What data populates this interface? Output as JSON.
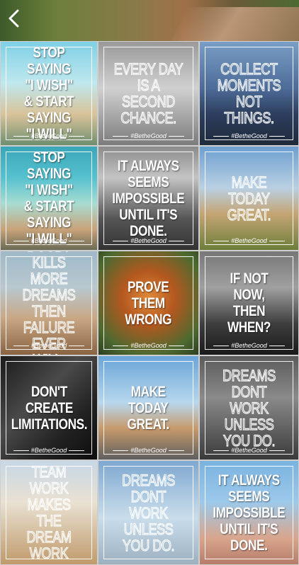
{
  "tiles": [
    {
      "text": "STOP SAYING\n\"I WISH\"\n& START SAYING\n\"I WILL\"",
      "tag": "#BetheGood",
      "bg": "linear-gradient(180deg,#7fd0e6 0%,#bfe8ee 40%,#d9c39a 70%,#6f8f70 100%)",
      "style": "solid"
    },
    {
      "text": "EVERY DAY\nIS A\nSECOND\nCHANCE.",
      "tag": "#BetheGood",
      "bg": "linear-gradient(180deg,#9a9a9a 0%,#d0d0d0 45%,#7c7c7c 100%)",
      "style": "outline"
    },
    {
      "text": "COLLECT\nMOMENTS\nNOT\nTHINGS.",
      "tag": "#BetheGood",
      "bg": "linear-gradient(180deg,#7a9ec6 0%,#4d6c98 45%,#2d3e5e 70%,#1f2a3a 100%)",
      "style": "outline"
    },
    {
      "text": "STOP SAYING\n\"I WISH\"\n& START SAYING\n\"I WILL\"",
      "tag": "#BetheGood",
      "bg": "linear-gradient(180deg,#3aa6b8 0%,#56c1cf 30%,#a7dcd2 55%,#c9a37a 80%,#6b6b55 100%)",
      "style": "solid"
    },
    {
      "text": "IT ALWAYS\nSEEMS IMPOSSIBLE\nUNTIL IT'S DONE.",
      "tag": "#BetheGood",
      "bg": "linear-gradient(180deg,#8b8b8b 0%,#c4c4c4 30%,#555 70%,#333 100%)",
      "style": "solid"
    },
    {
      "text": "MAKE\nTODAY\nGREAT.",
      "tag": "#BetheGood",
      "bg": "linear-gradient(180deg,#6d9fd0 0%,#b9d0e3 40%,#c5a574 65%,#6d7d3a 100%)",
      "style": "outline"
    },
    {
      "text": "DOUBT KILLS\nMORE DREAMS\nTHEN FAILURE\nEVER WILL.",
      "tag": "#BetheGood",
      "bg": "linear-gradient(180deg,#9fb9c9 0%,#b8c8cf 35%,#c9a784 65%,#8a6442 100%)",
      "style": "outline"
    },
    {
      "text": "PROVE\nTHEM\nWRONG",
      "tag": "#BetheGood",
      "bg": "radial-gradient(circle at 50% 45%,#e08a3a 0%,#b4581f 35%,#4e6a30 75%,#2c3e20 100%)",
      "style": "solid"
    },
    {
      "text": "IF NOT NOW,\nTHEN WHEN?",
      "tag": "#BetheGood",
      "bg": "linear-gradient(180deg,#777 0%,#a0a0a0 35%,#3e3e3e 70%,#1a1a1a 100%)",
      "style": "solid"
    },
    {
      "text": "DON'T\nCREATE\nLIMITATIONS.",
      "tag": "#BetheGood",
      "bg": "linear-gradient(135deg,#1b1b1b 0%,#4a4a4a 40%,#222 70%,#0d0d0d 100%)",
      "style": "solid"
    },
    {
      "text": "MAKE\nTODAY\nGREAT.",
      "tag": "#BetheGood",
      "bg": "linear-gradient(180deg,#6aa5d8 0%,#b7d7ee 45%,#c79a6b 70%,#5f5f5f 100%)",
      "style": "solid"
    },
    {
      "text": "DREAMS\nDONT WORK\nUNLESS\nYOU DO.",
      "tag": "#BetheGood",
      "bg": "linear-gradient(180deg,#5b5b5b 0%,#8a8a8a 40%,#3a3a3a 100%)",
      "style": "outline"
    },
    {
      "text": "TEAM WORK\nMAKES THE\nDREAM WORK",
      "tag": "",
      "bg": "linear-gradient(180deg,#c7d7e6 0%,#e9e1d2 40%,#c09a6b 100%)",
      "style": "outline"
    },
    {
      "text": "DREAMS\nDONT WORK\nUNLESS\nYOU DO.",
      "tag": "",
      "bg": "linear-gradient(180deg,#7fa8d0 0%,#c9ddeb 55%,#9cb0c0 100%)",
      "style": "outline"
    },
    {
      "text": "IT ALWAYS\nSEEMS IMPOSSIBLE\nUNTIL IT'S DONE.",
      "tag": "",
      "bg": "linear-gradient(180deg,#7ab3e0 0%,#9dc9ea 40%,#d9a58c 75%,#b57c6a 100%)",
      "style": "solid"
    }
  ]
}
